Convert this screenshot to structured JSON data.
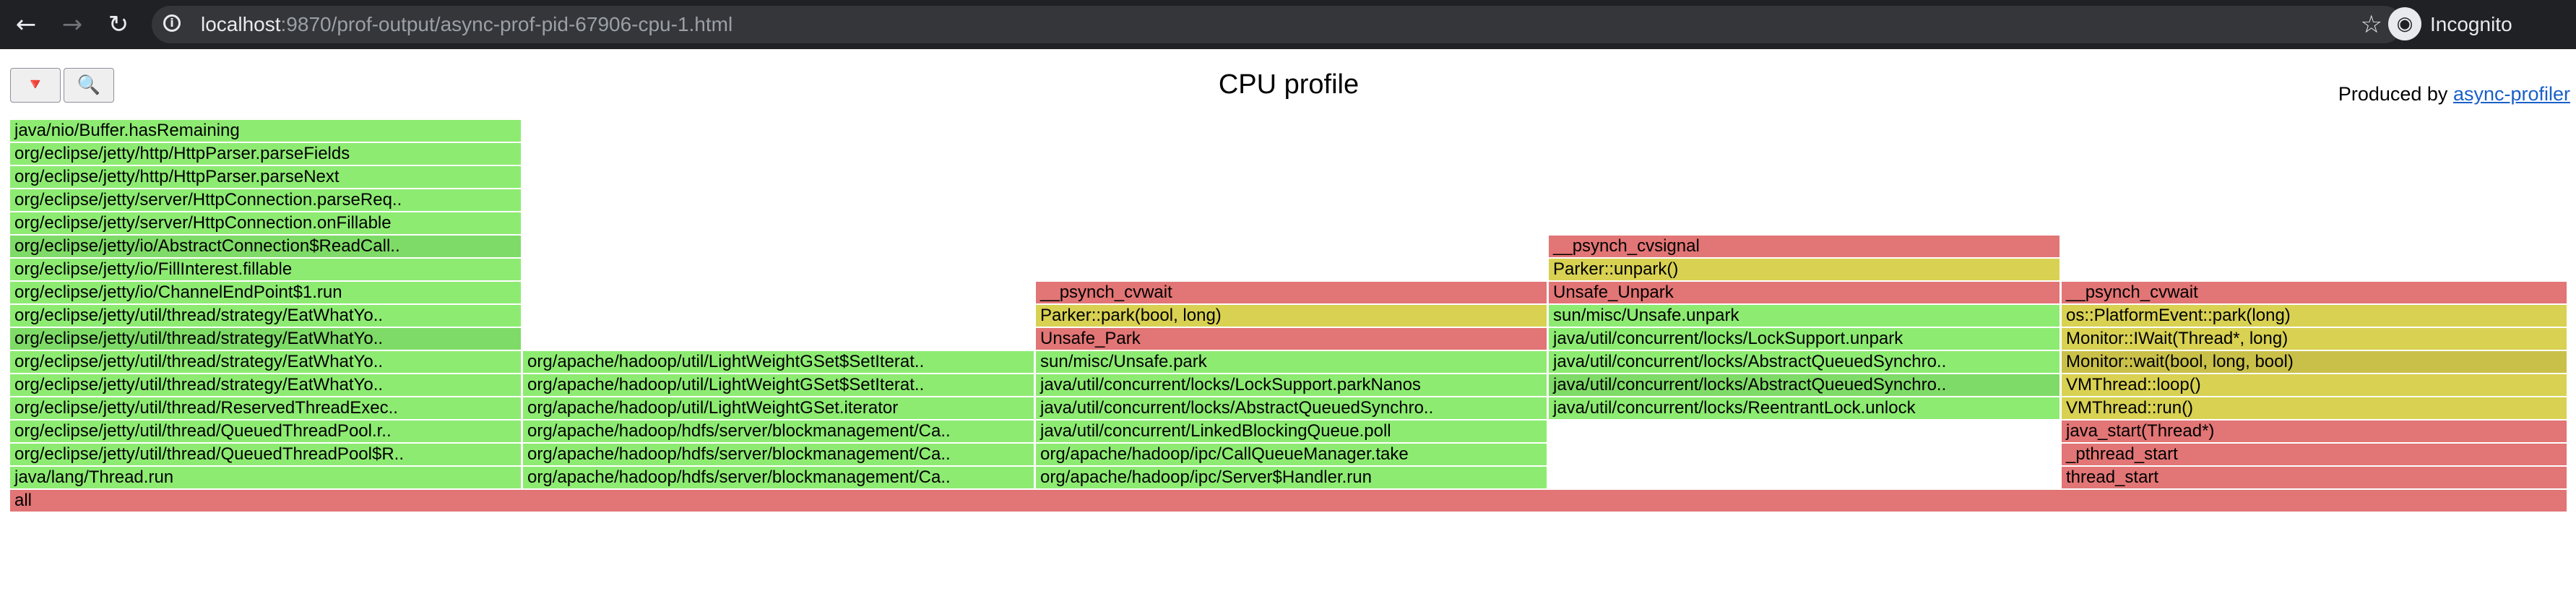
{
  "browser": {
    "url_host": "localhost",
    "url_rest": ":9870/prof-output/async-prof-pid-67906-cpu-1.html",
    "incognito_label": "Incognito",
    "back_icon": "arrow-left-icon",
    "forward_icon": "arrow-right-icon",
    "reload_icon": "reload-icon",
    "star_icon": "star-icon",
    "incognito_icon": "incognito-icon"
  },
  "page": {
    "title": "CPU profile",
    "produced_by": "Produced by ",
    "producer_link": "async-profiler",
    "reverse_button": "🔻",
    "search_button": "🔍"
  },
  "colors": {
    "green": "#8deb72",
    "green_alt": "#7fdb67",
    "red": "#e27575",
    "yellow": "#d8d152",
    "yellow_alt": "#c9c04a"
  },
  "flamegraph": {
    "frames": [
      {
        "depth": 0,
        "col": 0,
        "span": 5,
        "color": "red",
        "label": "all"
      },
      {
        "depth": 1,
        "col": 0,
        "span": 1,
        "color": "green",
        "label": "java/lang/Thread.run"
      },
      {
        "depth": 2,
        "col": 0,
        "span": 1,
        "color": "green",
        "label": "org/eclipse/jetty/util/thread/QueuedThreadPool$R.."
      },
      {
        "depth": 3,
        "col": 0,
        "span": 1,
        "color": "green",
        "label": "org/eclipse/jetty/util/thread/QueuedThreadPool.r.."
      },
      {
        "depth": 4,
        "col": 0,
        "span": 1,
        "color": "green",
        "label": "org/eclipse/jetty/util/thread/ReservedThreadExec.."
      },
      {
        "depth": 5,
        "col": 0,
        "span": 1,
        "color": "green",
        "label": "org/eclipse/jetty/util/thread/strategy/EatWhatYo.."
      },
      {
        "depth": 6,
        "col": 0,
        "span": 1,
        "color": "green",
        "label": "org/eclipse/jetty/util/thread/strategy/EatWhatYo.."
      },
      {
        "depth": 7,
        "col": 0,
        "span": 1,
        "color": "green_alt",
        "label": "org/eclipse/jetty/util/thread/strategy/EatWhatYo.."
      },
      {
        "depth": 8,
        "col": 0,
        "span": 1,
        "color": "green",
        "label": "org/eclipse/jetty/util/thread/strategy/EatWhatYo.."
      },
      {
        "depth": 9,
        "col": 0,
        "span": 1,
        "color": "green",
        "label": "org/eclipse/jetty/io/ChannelEndPoint$1.run"
      },
      {
        "depth": 10,
        "col": 0,
        "span": 1,
        "color": "green",
        "label": "org/eclipse/jetty/io/FillInterest.fillable"
      },
      {
        "depth": 11,
        "col": 0,
        "span": 1,
        "color": "green_alt",
        "label": "org/eclipse/jetty/io/AbstractConnection$ReadCall.."
      },
      {
        "depth": 12,
        "col": 0,
        "span": 1,
        "color": "green",
        "label": "org/eclipse/jetty/server/HttpConnection.onFillable"
      },
      {
        "depth": 13,
        "col": 0,
        "span": 1,
        "color": "green",
        "label": "org/eclipse/jetty/server/HttpConnection.parseReq.."
      },
      {
        "depth": 14,
        "col": 0,
        "span": 1,
        "color": "green",
        "label": "org/eclipse/jetty/http/HttpParser.parseNext"
      },
      {
        "depth": 15,
        "col": 0,
        "span": 1,
        "color": "green",
        "label": "org/eclipse/jetty/http/HttpParser.parseFields"
      },
      {
        "depth": 16,
        "col": 0,
        "span": 1,
        "color": "green",
        "label": "java/nio/Buffer.hasRemaining"
      },
      {
        "depth": 1,
        "col": 1,
        "span": 1,
        "color": "green",
        "label": "org/apache/hadoop/hdfs/server/blockmanagement/Ca.."
      },
      {
        "depth": 2,
        "col": 1,
        "span": 1,
        "color": "green",
        "label": "org/apache/hadoop/hdfs/server/blockmanagement/Ca.."
      },
      {
        "depth": 3,
        "col": 1,
        "span": 1,
        "color": "green",
        "label": "org/apache/hadoop/hdfs/server/blockmanagement/Ca.."
      },
      {
        "depth": 4,
        "col": 1,
        "span": 1,
        "color": "green",
        "label": "org/apache/hadoop/util/LightWeightGSet.iterator"
      },
      {
        "depth": 5,
        "col": 1,
        "span": 1,
        "color": "green",
        "label": "org/apache/hadoop/util/LightWeightGSet$SetIterat.."
      },
      {
        "depth": 6,
        "col": 1,
        "span": 1,
        "color": "green",
        "label": "org/apache/hadoop/util/LightWeightGSet$SetIterat.."
      },
      {
        "depth": 1,
        "col": 2,
        "span": 1,
        "color": "green",
        "label": "org/apache/hadoop/ipc/Server$Handler.run"
      },
      {
        "depth": 2,
        "col": 2,
        "span": 1,
        "color": "green",
        "label": "org/apache/hadoop/ipc/CallQueueManager.take"
      },
      {
        "depth": 3,
        "col": 2,
        "span": 1,
        "color": "green",
        "label": "java/util/concurrent/LinkedBlockingQueue.poll"
      },
      {
        "depth": 4,
        "col": 2,
        "span": 1,
        "color": "green",
        "label": "java/util/concurrent/locks/AbstractQueuedSynchro.."
      },
      {
        "depth": 5,
        "col": 2,
        "span": 1,
        "color": "green",
        "label": "java/util/concurrent/locks/LockSupport.parkNanos"
      },
      {
        "depth": 6,
        "col": 2,
        "span": 1,
        "color": "green",
        "label": "sun/misc/Unsafe.park"
      },
      {
        "depth": 7,
        "col": 2,
        "span": 1,
        "color": "red",
        "label": "Unsafe_Park"
      },
      {
        "depth": 8,
        "col": 2,
        "span": 1,
        "color": "yellow",
        "label": "Parker::park(bool, long)"
      },
      {
        "depth": 9,
        "col": 2,
        "span": 1,
        "color": "red",
        "label": "__psynch_cvwait"
      },
      {
        "depth": 4,
        "col": 3,
        "span": 1,
        "color": "green",
        "label": "java/util/concurrent/locks/ReentrantLock.unlock"
      },
      {
        "depth": 5,
        "col": 3,
        "span": 1,
        "color": "green_alt",
        "label": "java/util/concurrent/locks/AbstractQueuedSynchro.."
      },
      {
        "depth": 6,
        "col": 3,
        "span": 1,
        "color": "green",
        "label": "java/util/concurrent/locks/AbstractQueuedSynchro.."
      },
      {
        "depth": 7,
        "col": 3,
        "span": 1,
        "color": "green",
        "label": "java/util/concurrent/locks/LockSupport.unpark"
      },
      {
        "depth": 8,
        "col": 3,
        "span": 1,
        "color": "green",
        "label": "sun/misc/Unsafe.unpark"
      },
      {
        "depth": 9,
        "col": 3,
        "span": 1,
        "color": "red",
        "label": "Unsafe_Unpark"
      },
      {
        "depth": 10,
        "col": 3,
        "span": 1,
        "color": "yellow",
        "label": "Parker::unpark()"
      },
      {
        "depth": 11,
        "col": 3,
        "span": 1,
        "color": "red",
        "label": "__psynch_cvsignal"
      },
      {
        "depth": 1,
        "col": 4,
        "span": 1,
        "color": "red",
        "label": "thread_start"
      },
      {
        "depth": 2,
        "col": 4,
        "span": 1,
        "color": "red",
        "label": "_pthread_start"
      },
      {
        "depth": 3,
        "col": 4,
        "span": 1,
        "color": "red",
        "label": "java_start(Thread*)"
      },
      {
        "depth": 4,
        "col": 4,
        "span": 1,
        "color": "yellow",
        "label": "VMThread::run()"
      },
      {
        "depth": 5,
        "col": 4,
        "span": 1,
        "color": "yellow",
        "label": "VMThread::loop()"
      },
      {
        "depth": 6,
        "col": 4,
        "span": 1,
        "color": "yellow_alt",
        "label": "Monitor::wait(bool, long, bool)"
      },
      {
        "depth": 7,
        "col": 4,
        "span": 1,
        "color": "yellow",
        "label": "Monitor::IWait(Thread*, long)"
      },
      {
        "depth": 8,
        "col": 4,
        "span": 1,
        "color": "yellow",
        "label": "os::PlatformEvent::park(long)"
      },
      {
        "depth": 9,
        "col": 4,
        "span": 1,
        "color": "red",
        "label": "__psynch_cvwait"
      }
    ]
  }
}
